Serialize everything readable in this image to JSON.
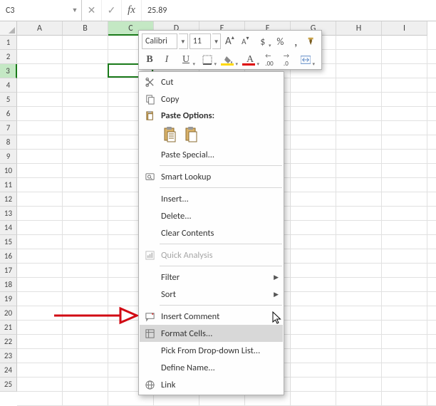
{
  "formula_bar": {
    "name_box_value": "C3",
    "formula_value": "25.89"
  },
  "mini_toolbar": {
    "font_name": "Calibri",
    "font_size": "11",
    "inc_font_glyph": "A",
    "dec_font_glyph": "A",
    "currency_glyph": "$",
    "percent_glyph": "%",
    "comma_glyph": ",",
    "bold_glyph": "B",
    "italic_glyph": "I",
    "underline_glyph": "U",
    "font_color_glyph": "A",
    "dec_decimal_glyph": ".00",
    "inc_decimal_glyph": ".0"
  },
  "columns": [
    "A",
    "B",
    "C",
    "D",
    "E",
    "F",
    "G",
    "H",
    "I"
  ],
  "selected_column_index": 2,
  "row_count": 25,
  "selected_row": 3,
  "active_cell": {
    "col": 2,
    "row": 3,
    "display": "25.89"
  },
  "context_menu": {
    "cut": "Cut",
    "copy": "Copy",
    "paste_options_header": "Paste Options:",
    "paste_special": "Paste Special...",
    "smart_lookup": "Smart Lookup",
    "insert": "Insert...",
    "delete": "Delete...",
    "clear_contents": "Clear Contents",
    "quick_analysis": "Quick Analysis",
    "filter": "Filter",
    "sort": "Sort",
    "insert_comment": "Insert Comment",
    "format_cells": "Format Cells...",
    "pick_from_dropdown": "Pick From Drop-down List...",
    "define_name": "Define Name...",
    "link": "Link"
  }
}
